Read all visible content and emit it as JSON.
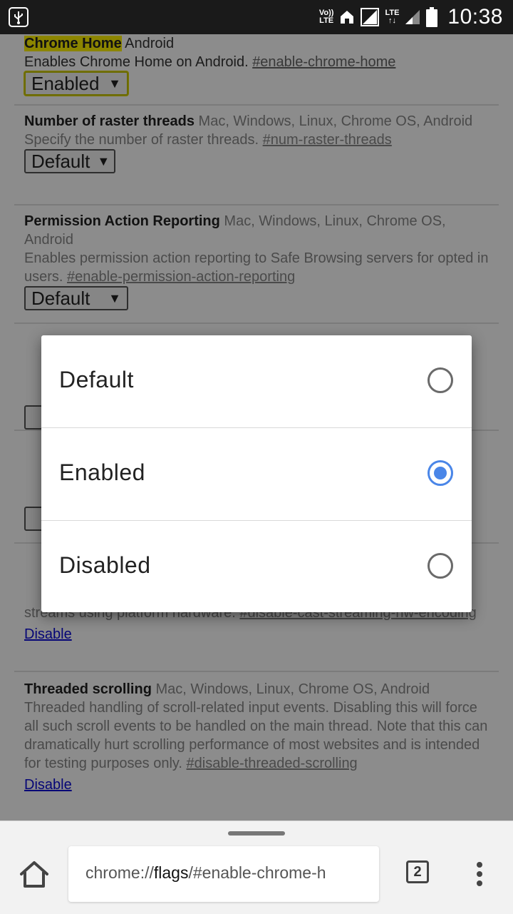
{
  "status_bar": {
    "volte_top": "Vo))",
    "volte_bottom": "LTE",
    "lte_top": "LTE",
    "lte_bottom": "↑↓",
    "time": "10:38"
  },
  "flags": [
    {
      "name": "Chrome Home",
      "platforms": "Android",
      "description": "Enables Chrome Home on Android.",
      "hash": "#enable-chrome-home",
      "control": "Enabled"
    },
    {
      "name": "Number of raster threads",
      "platforms": "Mac, Windows, Linux, Chrome OS, Android",
      "description": "Specify the number of raster threads.",
      "hash": "#num-raster-threads",
      "control": "Default"
    },
    {
      "name": "Permission Action Reporting",
      "platforms": "Mac, Windows, Linux, Chrome OS, Android",
      "description": "Enables permission action reporting to Safe Browsing servers for opted in users.",
      "hash": "#enable-permission-action-reporting",
      "control": "Default"
    },
    {
      "description_fragment": "streams using platform hardware.",
      "hash": "#disable-cast-streaming-hw-encoding",
      "link": "Disable"
    },
    {
      "name": "Threaded scrolling",
      "platforms": "Mac, Windows, Linux, Chrome OS, Android",
      "description": "Threaded handling of scroll-related input events. Disabling this will force all such scroll events to be handled on the main thread. Note that this can dramatically hurt scrolling performance of most websites and is intended for testing purposes only.",
      "hash": "#disable-threaded-scrolling",
      "link": "Disable"
    }
  ],
  "dialog": {
    "options": [
      {
        "label": "Default",
        "selected": false
      },
      {
        "label": "Enabled",
        "selected": true
      },
      {
        "label": "Disabled",
        "selected": false
      }
    ]
  },
  "bottom_bar": {
    "url_scheme": "chrome://",
    "url_host": "flags",
    "url_path": "/#enable-chrome-h",
    "tab_count": "2"
  },
  "colors": {
    "accent": "#4a86e8",
    "highlight": "#fff200",
    "link": "#0a0ad8"
  }
}
